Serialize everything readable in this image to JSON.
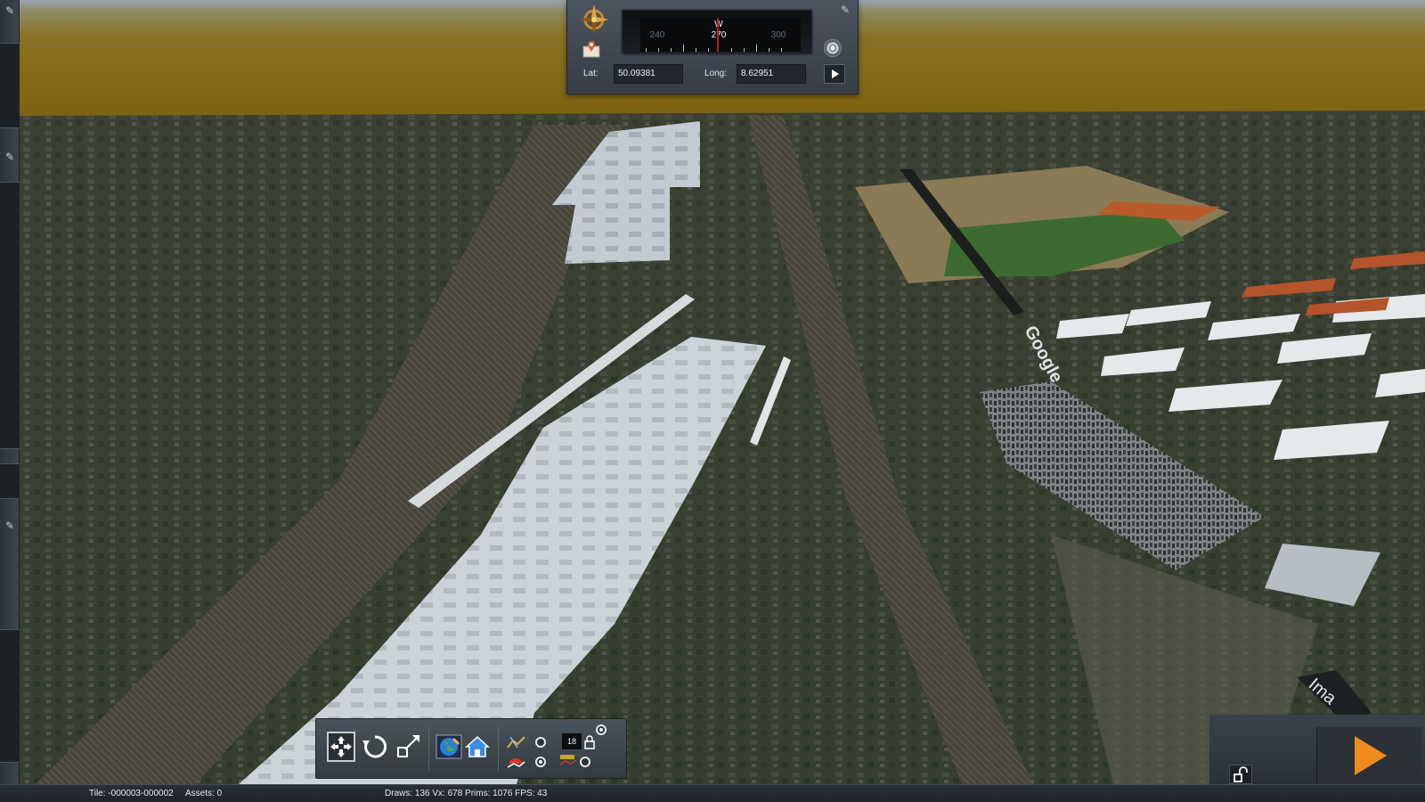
{
  "compass": {
    "direction": "W",
    "heading": "270",
    "tick_left": "240",
    "tick_right": "300"
  },
  "coordinates": {
    "lat_label": "Lat:",
    "lat_value": "50.09381",
    "long_label": "Long:",
    "long_value": "8.62951"
  },
  "toolbar": {
    "number_value": "18",
    "icons": [
      "fit-view-icon",
      "rotate-icon",
      "resize-icon",
      "globe-icon",
      "home-icon",
      "terrain-height-icon",
      "terrain-texture-icon",
      "lock-icon"
    ]
  },
  "map_overlay": {
    "watermark": "Google",
    "corner_label": "Ima"
  },
  "status": {
    "tile": "Tile: -000003-000002",
    "assets": "Assets: 0",
    "stats": "Draws: 136 Vx: 678 Prims: 1076 FPS: 43"
  },
  "colors": {
    "sky_brown": "#7c6210",
    "panel": "#3c444d",
    "play_orange": "#f08a1c",
    "grid_green": "#39d04c",
    "needle_red": "#c21d1d"
  }
}
